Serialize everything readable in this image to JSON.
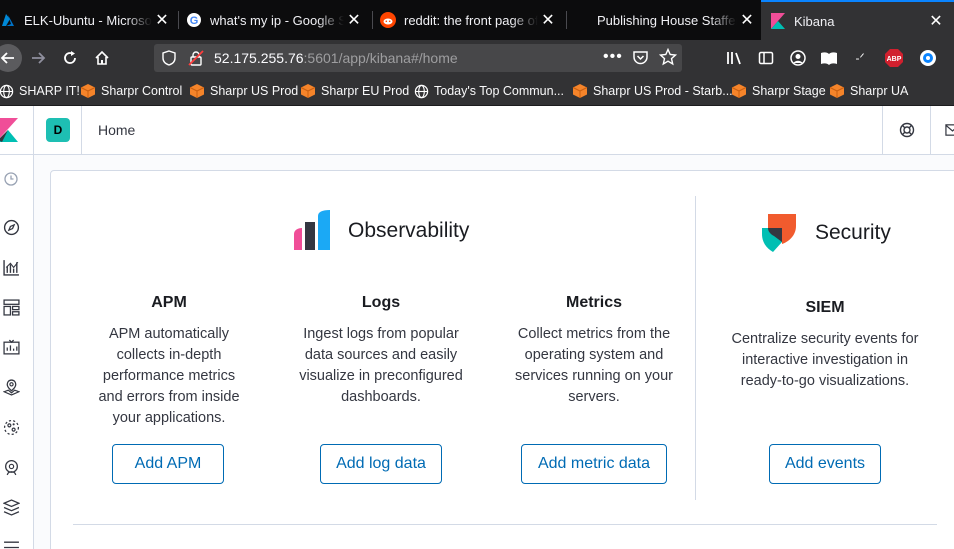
{
  "browser": {
    "tabs": [
      {
        "title": "ELK-Ubuntu - Microsoft Azure",
        "icon": "azure-icon"
      },
      {
        "title": "what's my ip - Google Search",
        "icon": "google-icon"
      },
      {
        "title": "reddit: the front page of the internet",
        "icon": "reddit-icon"
      },
      {
        "title": "Publishing House Staffers",
        "icon": "none"
      },
      {
        "title": "Kibana",
        "icon": "kibana-icon",
        "active": true
      }
    ],
    "url": {
      "host": "52.175.255.76",
      "rest": ":5601/app/kibana#/home"
    },
    "bookmarks": [
      {
        "label": "SHARP IT!",
        "icon": "globe-icon"
      },
      {
        "label": "Sharpr Control",
        "icon": "sharpr-cube-icon"
      },
      {
        "label": "Sharpr US Prod",
        "icon": "sharpr-cube-icon"
      },
      {
        "label": "Sharpr EU Prod",
        "icon": "sharpr-cube-icon"
      },
      {
        "label": "Today's Top Commun...",
        "icon": "globe-icon"
      },
      {
        "label": "Sharpr US Prod - Starb...",
        "icon": "sharpr-cube-icon"
      },
      {
        "label": "Sharpr Stage",
        "icon": "sharpr-cube-icon"
      },
      {
        "label": "Sharpr UA",
        "icon": "sharpr-cube-icon"
      }
    ],
    "addon_label": "ABP",
    "colors": {
      "accent": "#0a84ff",
      "chrome": "#323234",
      "tabbar": "#0c0c0d"
    }
  },
  "kibana": {
    "space_initial": "D",
    "breadcrumb": "Home",
    "observability": {
      "title": "Observability",
      "solutions": [
        {
          "title": "APM",
          "description": "APM automatically collects in-depth performance metrics and errors from inside your applications.",
          "button": "Add APM"
        },
        {
          "title": "Logs",
          "description": "Ingest logs from popular data sources and easily visualize in preconfigured dashboards.",
          "button": "Add log data"
        },
        {
          "title": "Metrics",
          "description": "Collect metrics from the operating system and services running on your servers.",
          "button": "Add metric data"
        }
      ]
    },
    "security": {
      "title": "Security",
      "solution": {
        "title": "SIEM",
        "description": "Centralize security events for interactive investigation in ready-to-go visualizations.",
        "button": "Add events"
      }
    },
    "colors": {
      "primary": "#006bb4",
      "space_badge": "#1ebfb3",
      "text": "#343741"
    }
  }
}
